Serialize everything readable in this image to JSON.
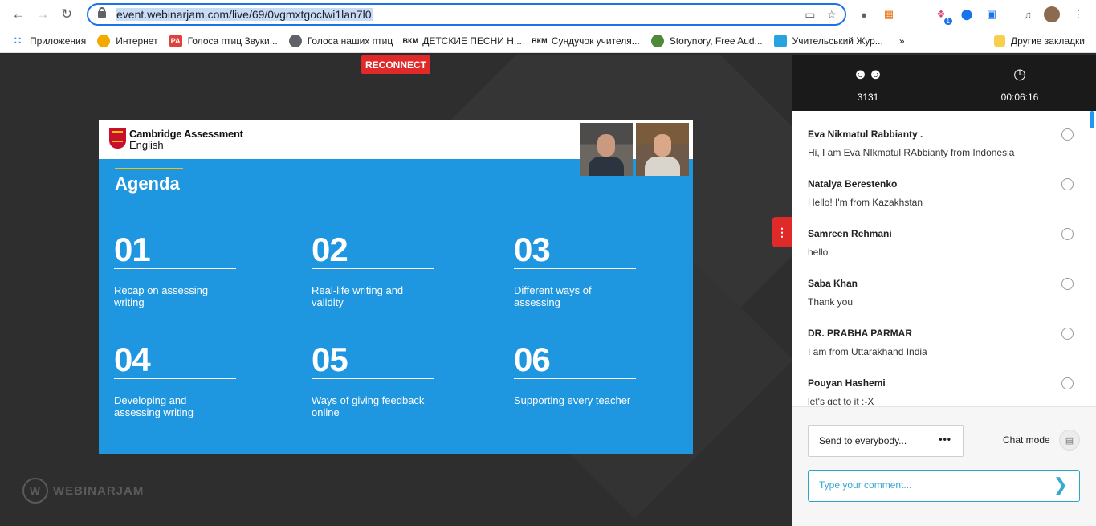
{
  "browser": {
    "url": "event.webinarjam.com/live/69/0vgmxtgoclwi1lan7l0",
    "extension_badge": "1"
  },
  "bookmarks": [
    {
      "label": "Приложения",
      "icon": "apps-grid-icon"
    },
    {
      "label": "Интернет",
      "icon": "globe-icon"
    },
    {
      "label": "Голоса птиц Звуки...",
      "icon": "papa-icon"
    },
    {
      "label": "Голоса наших птиц",
      "icon": "globe-icon"
    },
    {
      "label": "ДЕТСКИЕ ПЕСНИ Н...",
      "icon": "bkm-icon"
    },
    {
      "label": "Сундучок учителя...",
      "icon": "bkm-icon"
    },
    {
      "label": "Storynory, Free Aud...",
      "icon": "storynory-icon"
    },
    {
      "label": "Учительський Жур...",
      "icon": "journal-icon"
    }
  ],
  "bookmarks_overflow": "»",
  "bookmarks_other": "Другие закладки",
  "stage": {
    "reconnect_label": "RECONNECT",
    "logo_text": "WEBINARJAM",
    "slide": {
      "brand_line1": "Cambridge Assessment",
      "brand_line2": "English",
      "heading": "Agenda",
      "items": [
        {
          "num": "01",
          "text": "Recap on assessing writing"
        },
        {
          "num": "02",
          "text": "Real-life writing and validity"
        },
        {
          "num": "03",
          "text": "Different ways of assessing"
        },
        {
          "num": "04",
          "text": "Developing and assessing writing"
        },
        {
          "num": "05",
          "text": "Ways of giving feedback online"
        },
        {
          "num": "06",
          "text": "Supporting every teacher"
        }
      ]
    }
  },
  "panel": {
    "attendees": "3131",
    "elapsed": "00:06:16",
    "messages": [
      {
        "name": "Eva Nikmatul Rabbianty .",
        "text": "Hi, I am Eva NIkmatul RAbbianty from Indonesia"
      },
      {
        "name": "Natalya Berestenko",
        "text": "Hello! I'm from Kazakhstan"
      },
      {
        "name": "Samreen Rehmani",
        "text": "hello"
      },
      {
        "name": "Saba Khan",
        "text": "Thank you"
      },
      {
        "name": "DR. PRABHA PARMAR",
        "text": "I am from Uttarakhand India"
      },
      {
        "name": "Pouyan Hashemi",
        "text": "let's get to it :-X"
      }
    ],
    "send_to_label": "Send to everybody...",
    "chat_mode_label": "Chat mode",
    "comment_placeholder": "Type your comment..."
  }
}
